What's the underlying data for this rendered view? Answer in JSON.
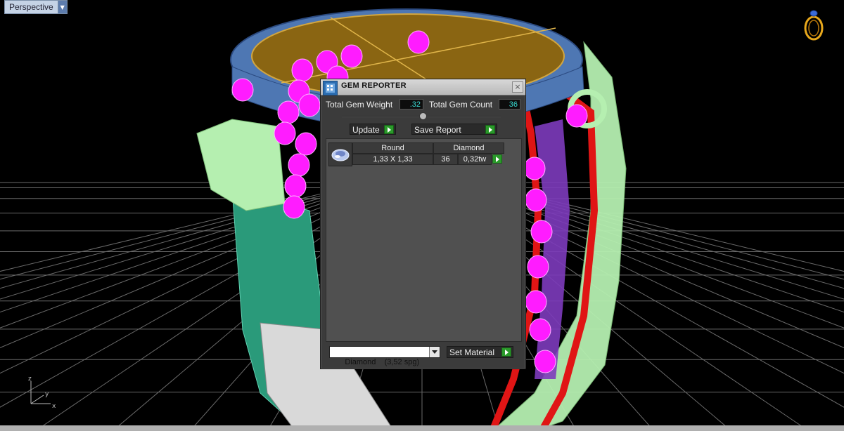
{
  "viewport": {
    "label": "Perspective"
  },
  "dialog": {
    "title": "GEM REPORTER",
    "close_glyph": "×",
    "total_weight_label": "Total Gem Weight",
    "total_weight_value": ".32",
    "total_count_label": "Total Gem Count",
    "total_count_value": "36",
    "update_label": "Update",
    "save_report_label": "Save Report",
    "gem_list": {
      "header_shape": "Round",
      "header_material": "Diamond",
      "size": "1,33 X 1,33",
      "count": "36",
      "weight": "0,32tw"
    },
    "material_select": {
      "value": "Diamond    (3,52 spg)"
    },
    "set_material_label": "Set Material"
  },
  "icons": {
    "viewport_dropdown": "triangle-down-icon",
    "dialog_app": "gem-reporter-icon",
    "close": "close-icon",
    "play": "play-icon",
    "gem_thumb": "round-gem-icon",
    "ring_preview": "ring-icon",
    "axis": "axis-triad-icon"
  },
  "colors": {
    "accent_green": "#2a9a2a",
    "value_cyan": "#38d8d0",
    "gem_magenta": "#ff1cff",
    "ring_gold": "#8a6512",
    "mesh_green": "#b5efb0",
    "prong_red": "#e01515",
    "pave_purple": "#7d3bbd"
  }
}
